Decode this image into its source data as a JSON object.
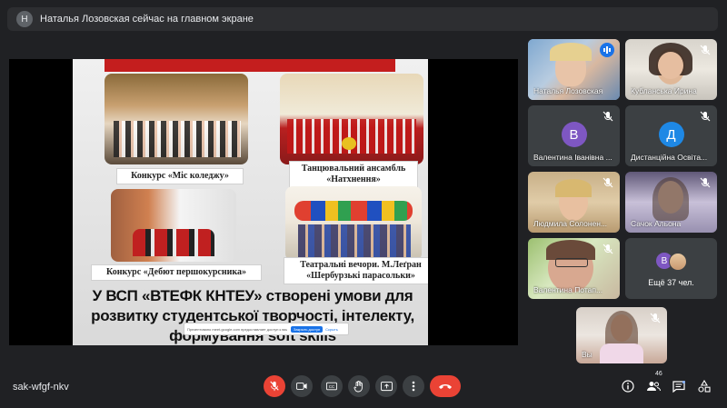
{
  "banner": {
    "avatar_letter": "Н",
    "text": "Наталья Лозовская сейчас на главном экране"
  },
  "slide": {
    "captions": [
      "Конкурс «Міс коледжу»",
      "Танцювальний ансамбль «Натхнення»",
      "Конкурс «Дебют першокурсника»",
      "Театральні вечори. М.Леґран «Шербурзькі парасольки»"
    ],
    "headline_lines": [
      "У ВСП «ВТЕФК КНТЕУ» створені умови для",
      "розвитку студентської творчості, інтелекту,",
      "формування soft skills"
    ],
    "share_bar": {
      "text": "Презентовано meet.google.com предоставляет доступ к вашему экрану.",
      "stop_label": "Закрыть доступ",
      "hide_label": "Скрыть"
    }
  },
  "tiles": [
    {
      "name": "Наталья Лозовская",
      "type": "video",
      "speaking": true
    },
    {
      "name": "Кубланська Ирина",
      "type": "video",
      "muted": true
    },
    {
      "name": "Валентина Іванівна ...",
      "type": "avatar",
      "letter": "В",
      "color": "#7e57c2",
      "muted": true
    },
    {
      "name": "Дистанційна Освіта...",
      "type": "avatar",
      "letter": "Д",
      "color": "#1e88e5",
      "muted": true
    },
    {
      "name": "Людмила Солонен...",
      "type": "video",
      "muted": true
    },
    {
      "name": "Сачок Альона",
      "type": "video",
      "muted": true
    },
    {
      "name": "Валентина Потап...",
      "type": "video",
      "muted": true
    },
    {
      "name": "Ещё 37 чел.",
      "type": "more",
      "letter": "В",
      "color": "#7e57c2"
    },
    {
      "name": "Вы",
      "type": "video",
      "muted": true
    }
  ],
  "bottom": {
    "meeting_code": "sak-wfgf-nkv",
    "participants_count": "46"
  },
  "icons": {
    "mic_off": "mic-off-icon",
    "camera": "camera-icon",
    "captions": "captions-icon",
    "hand": "raise-hand-icon",
    "present": "present-icon",
    "more": "more-vert-icon",
    "hangup": "hangup-icon",
    "info": "info-icon",
    "people": "people-icon",
    "chat": "chat-icon",
    "activities": "activities-icon"
  }
}
